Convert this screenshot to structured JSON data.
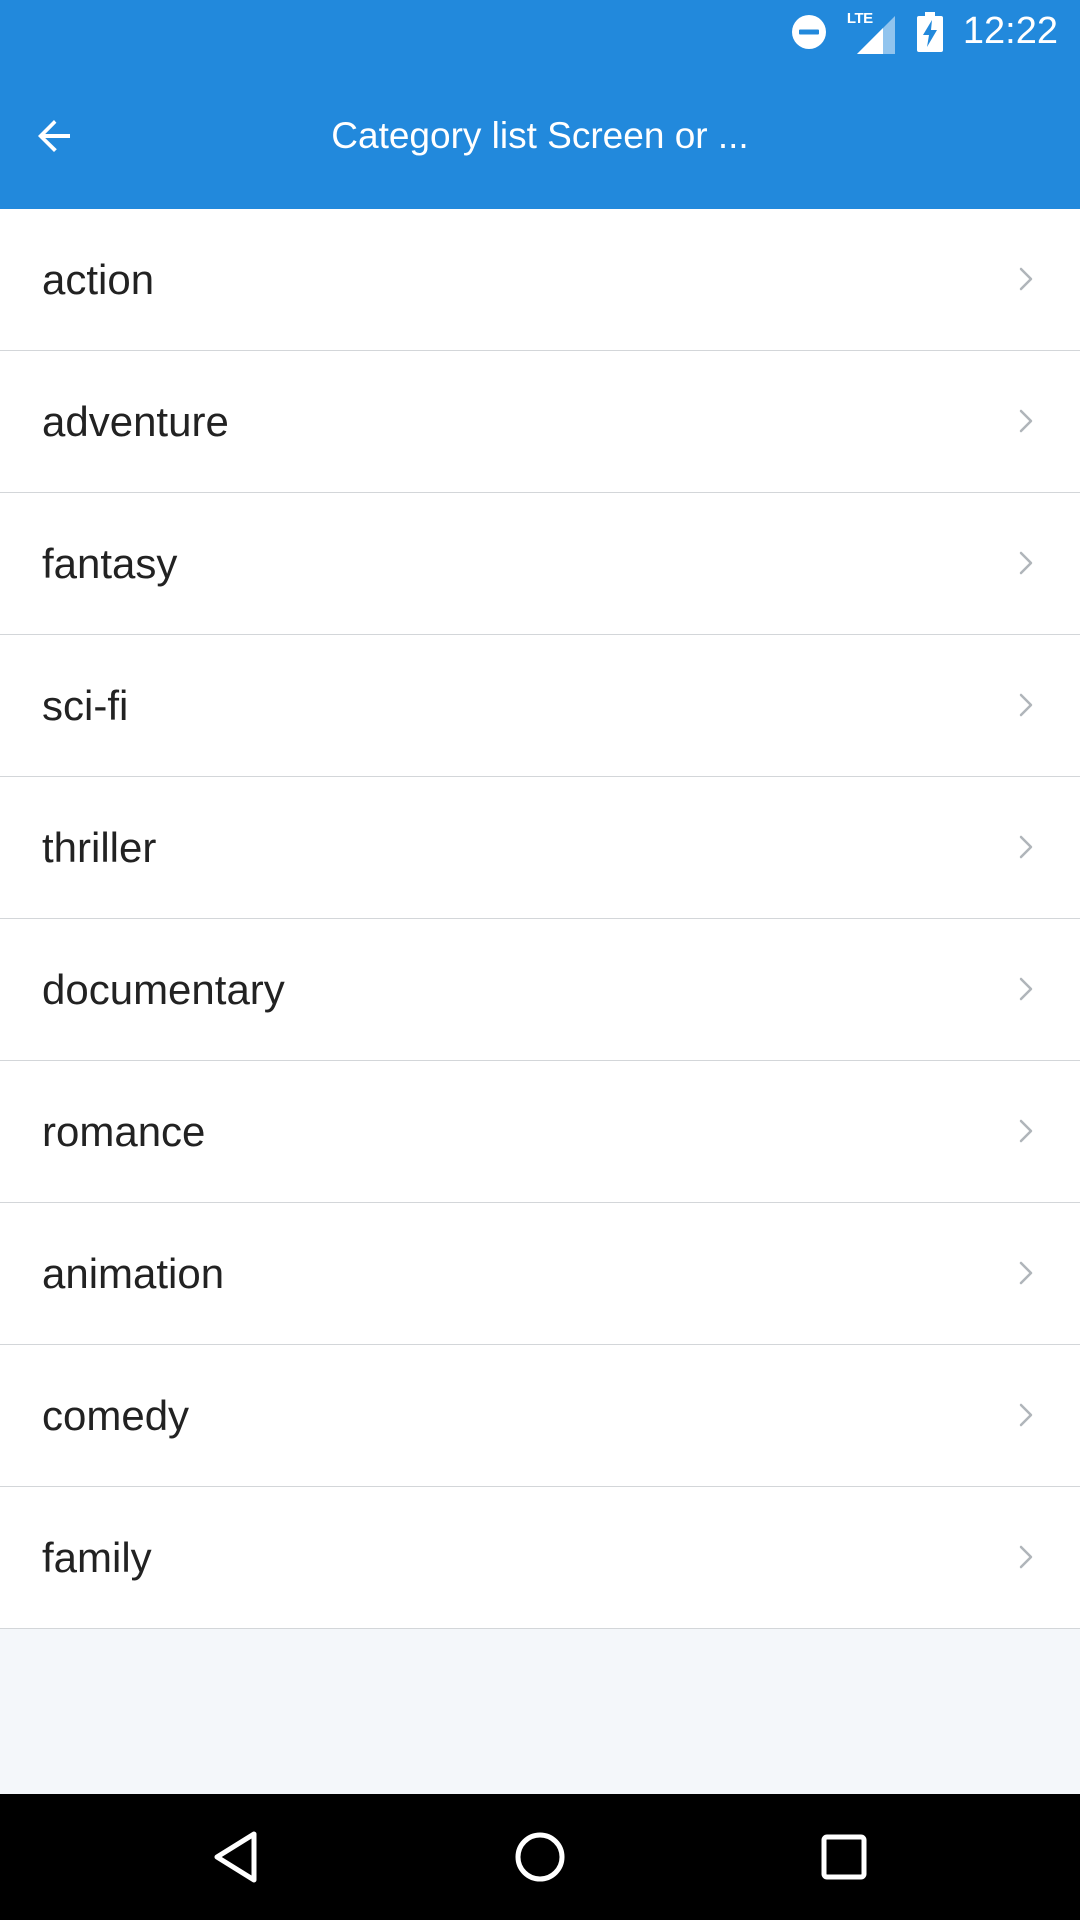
{
  "status_bar": {
    "time": "12:22",
    "network_label": "LTE",
    "icons": [
      "do-not-disturb-icon",
      "signal-icon",
      "battery-charging-icon"
    ]
  },
  "app_bar": {
    "title": "Category list Screen or ...",
    "back_icon": "arrow-left-icon"
  },
  "categories": [
    {
      "label": "action"
    },
    {
      "label": "adventure"
    },
    {
      "label": "fantasy"
    },
    {
      "label": "sci-fi"
    },
    {
      "label": "thriller"
    },
    {
      "label": "documentary"
    },
    {
      "label": "romance"
    },
    {
      "label": "animation"
    },
    {
      "label": "comedy"
    },
    {
      "label": "family"
    }
  ],
  "nav_bar": {
    "icons": [
      "nav-back-icon",
      "nav-home-icon",
      "nav-recents-icon"
    ]
  },
  "colors": {
    "primary": "#2289dc",
    "list_background": "#ffffff",
    "page_background": "#f4f7fa",
    "divider": "#d3d6d9",
    "text": "#222222",
    "chevron": "#b0b5ba"
  }
}
